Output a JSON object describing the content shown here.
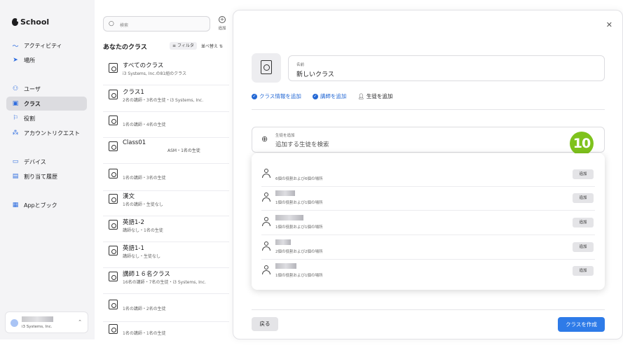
{
  "sidebar": {
    "brand": "School",
    "items": [
      {
        "label": "アクティビティ",
        "icon": "activity-icon"
      },
      {
        "label": "場所",
        "icon": "location-icon"
      },
      {
        "label": "ユーザ",
        "icon": "users-icon"
      },
      {
        "label": "クラス",
        "icon": "class-icon",
        "active": true
      },
      {
        "label": "役割",
        "icon": "flag-icon"
      },
      {
        "label": "アカウントリクエスト",
        "icon": "account-request-icon"
      },
      {
        "label": "デバイス",
        "icon": "laptop-icon"
      },
      {
        "label": "割り当て履歴",
        "icon": "history-icon"
      },
      {
        "label": "Appとブック",
        "icon": "apps-books-icon"
      }
    ],
    "user": {
      "org": "i3 Systems, Inc."
    }
  },
  "class_list": {
    "search_placeholder": "検索",
    "add_label": "追加",
    "title": "あなたのクラス",
    "filter_label": "フィルタ",
    "sort_label": "並べ替え",
    "rows": [
      {
        "name": "すべてのクラス",
        "sub": "i3 Systems, Inc.の81組のクラス"
      },
      {
        "name": "クラス1",
        "sub": "2名の講師・3名の生徒・i3 Systems, Inc."
      },
      {
        "name": "",
        "sub": "1名の講師・4名の生徒"
      },
      {
        "name": "Class01",
        "sub": "",
        "side": "ASM・1名の生徒"
      },
      {
        "name": "",
        "sub": "1名の講師・3名の生徒"
      },
      {
        "name": "漢文",
        "sub": "1名の講師・生徒なし"
      },
      {
        "name": "英語1-2",
        "sub": "講師なし・1名の生徒"
      },
      {
        "name": "英語1-1",
        "sub": "講師なし・生徒なし"
      },
      {
        "name": "講師１６名クラス",
        "sub": "16名の講師・7名の生徒・i3 Systems, Inc."
      },
      {
        "name": "",
        "sub": "1名の講師・2名の生徒"
      },
      {
        "name": "",
        "sub": "1名の講師・1名の生徒"
      }
    ]
  },
  "modal": {
    "name_label": "名前",
    "name_value": "新しいクラス",
    "steps": [
      {
        "label": "クラス情報を追加",
        "done": true
      },
      {
        "label": "講師を追加",
        "done": true
      },
      {
        "label": "生徒を追加",
        "done": false
      }
    ],
    "student_search_label": "生徒を追加",
    "student_search_placeholder": "追加する生徒を検索",
    "badge": "10",
    "results": [
      {
        "desc": "6個の役割および6個の場所",
        "add": "追加"
      },
      {
        "desc": "1個の役割および1個の場所",
        "add": "追加"
      },
      {
        "desc": "1個の役割および1個の場所",
        "add": "追加"
      },
      {
        "desc": "2個の役割および2個の場所",
        "add": "追加"
      },
      {
        "desc": "1個の役割および1個の場所",
        "add": "追加"
      }
    ],
    "back_label": "戻る",
    "create_label": "クラスを作成"
  },
  "colors": {
    "accent": "#2e7be8",
    "badge": "#7ec21c"
  }
}
